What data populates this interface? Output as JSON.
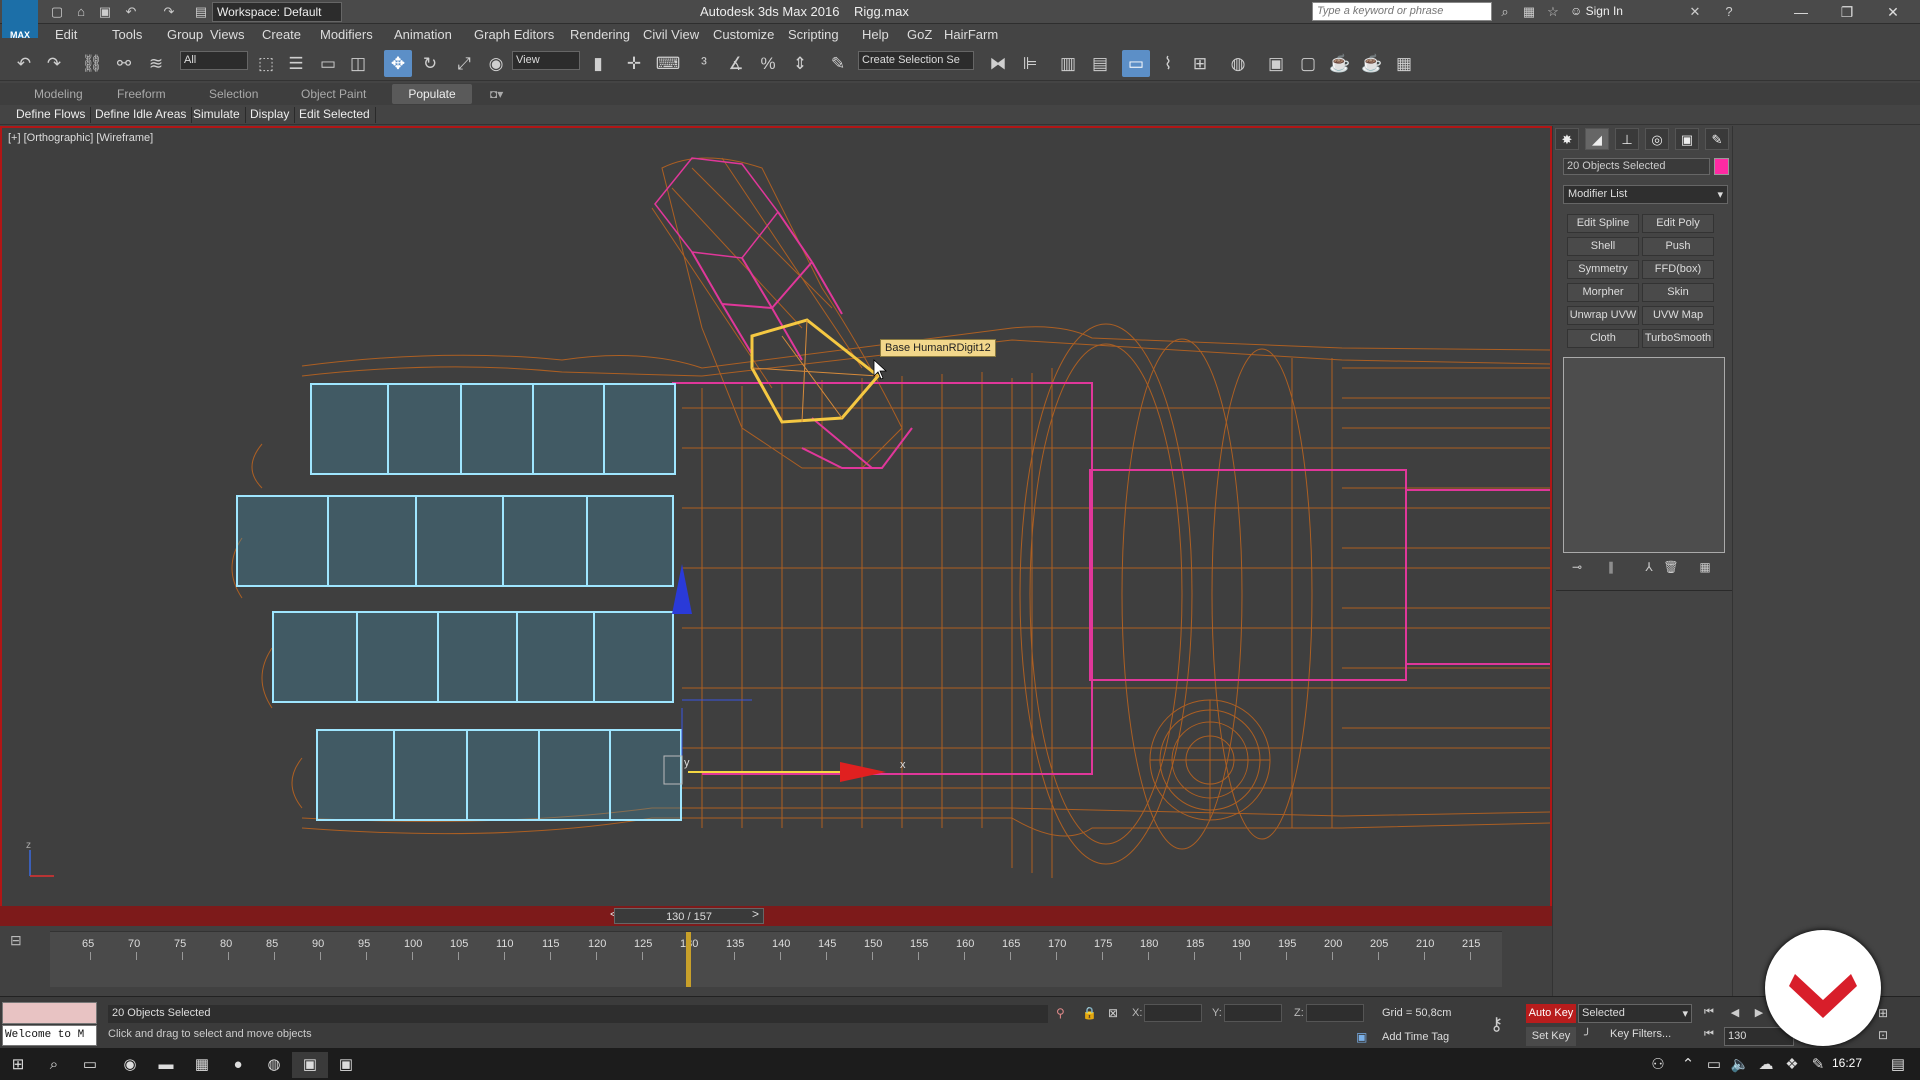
{
  "app": {
    "window_title": "Autodesk 3ds Max 2016",
    "file_name": "Rigg.max",
    "logo_text": "MAX",
    "workspace": "Workspace: Default",
    "search_placeholder": "Type a keyword or phrase",
    "sign_in": "Sign In"
  },
  "menus": [
    "Edit",
    "Tools",
    "Group",
    "Views",
    "Create",
    "Modifiers",
    "Animation",
    "Graph Editors",
    "Rendering",
    "Civil View",
    "Customize",
    "Scripting",
    "Help",
    "GoZ",
    "HairFarm"
  ],
  "toolbar": {
    "selection_filter": "All",
    "ref_coord": "View",
    "named_selection": "Create Selection Se"
  },
  "ribbon": {
    "tabs": [
      "Modeling",
      "Freeform",
      "Selection",
      "Object Paint",
      "Populate"
    ],
    "active_tab": "Populate",
    "populate_buttons": [
      "Define Flows",
      "Define Idle Areas",
      "Simulate",
      "Display",
      "Edit Selected"
    ]
  },
  "viewport": {
    "label": "[+] [Orthographic] [Wireframe]",
    "tooltip": "Base HumanRDigit12",
    "frame_counter": "130 / 157",
    "gizmo_x": "x",
    "gizmo_y": "y",
    "gizmo_z": "z"
  },
  "command_panel": {
    "tabs": [
      "create-icon",
      "modify-icon",
      "hierarchy-icon",
      "motion-icon",
      "display-icon",
      "utilities-icon"
    ],
    "selection_name": "20 Objects Selected",
    "selection_color": "#ff2aa3",
    "modifier_list": "Modifier List",
    "modifier_buttons": [
      "Edit Spline",
      "Edit Poly",
      "Shell",
      "Push",
      "Symmetry",
      "FFD(box)",
      "Morpher",
      "Skin",
      "Unwrap UVW",
      "UVW Map",
      "Cloth",
      "TurboSmooth"
    ]
  },
  "timeline": {
    "ticks": [
      "65",
      "70",
      "75",
      "80",
      "85",
      "90",
      "95",
      "100",
      "105",
      "110",
      "115",
      "120",
      "125",
      "130",
      "135",
      "140",
      "145",
      "150",
      "155",
      "160",
      "165",
      "170",
      "175",
      "180",
      "185",
      "190",
      "195",
      "200",
      "205",
      "210",
      "215"
    ],
    "current_frame": 130
  },
  "status": {
    "maxscript_listener": "Welcome to M",
    "selection_count": "20 Objects Selected",
    "prompt": "Click and drag to select and move objects",
    "x_label": "X:",
    "y_label": "Y:",
    "z_label": "Z:",
    "grid": "Grid = 50,8cm",
    "auto_key": "Auto Key",
    "key_mode": "Selected",
    "set_key": "Set Key",
    "key_filters": "Key Filters...",
    "add_time_tag": "Add Time Tag",
    "current_frame_field": "130"
  },
  "taskbar": {
    "clock": "16:27"
  },
  "colors": {
    "accent_active": "#5c8fc7",
    "viewport_border": "#b11616",
    "wire_orange": "#c0651e",
    "wire_pink": "#e0379a",
    "selected_blue": "#9fe6ff",
    "highlight_yellow": "#f5c842"
  }
}
